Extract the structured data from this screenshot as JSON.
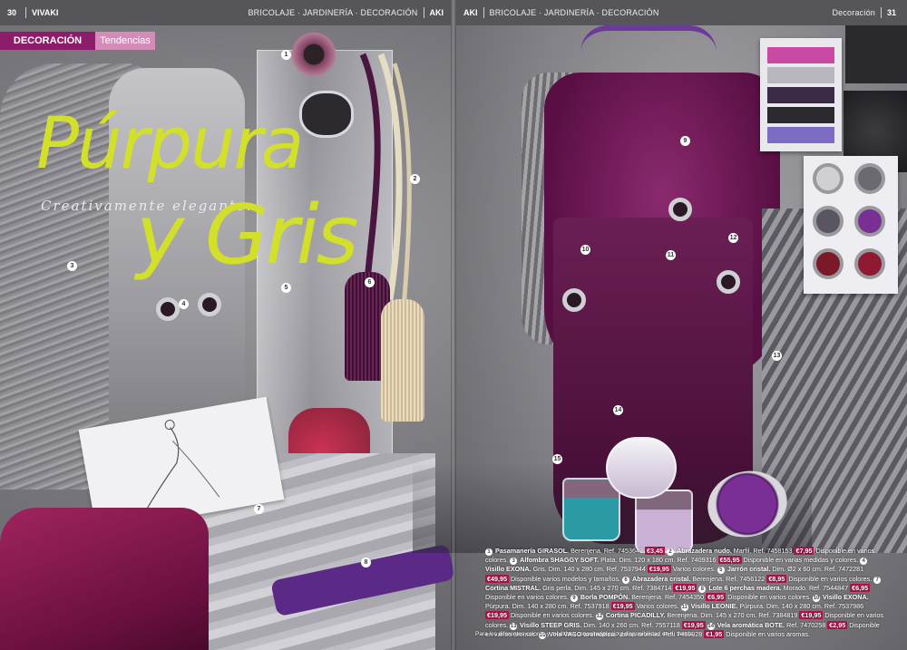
{
  "header": {
    "left_page_number": "30",
    "left_brand": "VIVAKI",
    "left_sections": "BRICOLAJE · JARDINERÍA · DECORACIÓN",
    "left_store": "AKI",
    "right_store": "AKI",
    "right_sections": "BRICOLAJE · JARDINERÍA · DECORACIÓN",
    "right_section_label": "Decoración",
    "right_page_number": "31"
  },
  "tabs": {
    "decoracion": "DECORACIÓN",
    "tendencias": "Tendencias"
  },
  "title": {
    "line1": "Púrpura",
    "line2": "y Gris",
    "subtitle": "Creativamente elegante."
  },
  "callouts": [
    "1",
    "2",
    "3",
    "4",
    "5",
    "6",
    "7",
    "8",
    "9",
    "10",
    "11",
    "12",
    "13",
    "14",
    "15"
  ],
  "colors": {
    "accent": "#d3e02a",
    "brand": "#8d1d6b",
    "price_tag": "#b8124f",
    "header": "#565559"
  },
  "products": [
    {
      "n": "1",
      "name": "Pasamanería GIRASOL.",
      "desc": "Berenjena. Ref. 7453642",
      "price": "€3,45",
      "avail": ""
    },
    {
      "n": "2",
      "name": "Abrazadera nudo.",
      "desc": "Marfil. Ref. 7458153",
      "price": "€7,95",
      "avail": "Disponible en varios colores."
    },
    {
      "n": "3",
      "name": "Alfombra SHAGGY SOFT.",
      "desc": "Plata. Dim. 120 x 180 cm. Ref. 7409316",
      "price": "€55,95",
      "avail": "Disponible en varias medidas y colores."
    },
    {
      "n": "4",
      "name": "Visillo EXONA.",
      "desc": "Gris. Dim. 140 x 280 cm. Ref. 7537944",
      "price": "€19,95",
      "avail": "Varios colores."
    },
    {
      "n": "5",
      "name": "Jarrón cristal.",
      "desc": "Dim. Ø2 x 60 cm. Ref. 7472281",
      "price": "€49,95",
      "avail": "Disponible varios modelos y tamaños."
    },
    {
      "n": "6",
      "name": "Abrazadera cristal.",
      "desc": "Berenjena. Ref. 7456122",
      "price": "€8,95",
      "avail": "Disponible en varios colores."
    },
    {
      "n": "7",
      "name": "Cortina MISTRAL.",
      "desc": "Gris perla. Dim. 145 x 270 cm. Ref. 7384714",
      "price": "€19,95",
      "avail": ""
    },
    {
      "n": "8",
      "name": "Lote 6 perchas madera.",
      "desc": "Morado. Ref. 7544847",
      "price": "€6,95",
      "avail": "Disponible en varios colores."
    },
    {
      "n": "9",
      "name": "Borla POMPÓN.",
      "desc": "Berenjena. Ref. 7454350",
      "price": "€6,95",
      "avail": "Disponible en varios colores."
    },
    {
      "n": "10",
      "name": "Visillo EXONA.",
      "desc": "Púrpura. Dim. 140 x 280 cm. Ref. 7537918",
      "price": "€19,95",
      "avail": "Varios colores."
    },
    {
      "n": "11",
      "name": "Visillo LEONIE.",
      "desc": "Púrpura. Dim. 140 x 280 cm. Ref. 7537986",
      "price": "€19,95",
      "avail": "Disponible en varios colores."
    },
    {
      "n": "12",
      "name": "Cortina PICADILLY.",
      "desc": "Berenjena. Dim. 145 x 270 cm. Ref. 7384819",
      "price": "€19,95",
      "avail": "Disponible en varios colores."
    },
    {
      "n": "13",
      "name": "Visillo STEEP GRIS.",
      "desc": "Dim. 140 x 260 cm. Ref. 7557118",
      "price": "€19,95",
      "avail": ""
    },
    {
      "n": "14",
      "name": "Vela aromática BOTE.",
      "desc": "Ref. 7470258",
      "price": "€2,95",
      "avail": "Disponible en varios aromas."
    },
    {
      "n": "15",
      "name": "Vela VASO aromática.",
      "desc": "Varios aromas. Ref. 7469928",
      "price": "€1,95",
      "avail": "Disponible en varios aromas."
    }
  ],
  "footnote": "Para los diferentes colores y medidas, consultar precio y disponibilidad en tu tienda."
}
